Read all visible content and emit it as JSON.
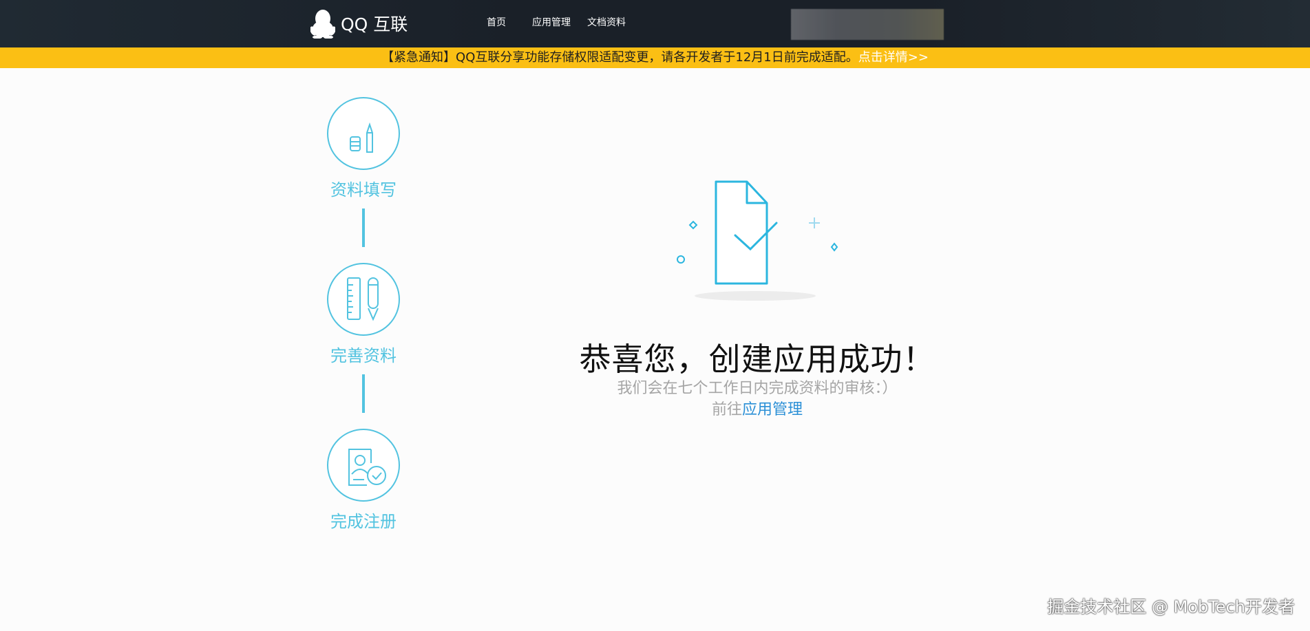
{
  "header": {
    "logo_text": "QQ 互联",
    "nav": [
      "首页",
      "应用管理",
      "文档资料"
    ]
  },
  "notice": {
    "text": "【紧急通知】QQ互联分享功能存储权限适配变更，请各开发者于12月1日前完成适配。",
    "link_text": "点击详情>>"
  },
  "steps": [
    {
      "label": "资料填写",
      "icon": "edit-tools-icon"
    },
    {
      "label": "完善资料",
      "icon": "ruler-pen-icon"
    },
    {
      "label": "完成注册",
      "icon": "profile-check-icon"
    }
  ],
  "main": {
    "title": "恭喜您，创建应用成功！",
    "subtitle": "我们会在七个工作日内完成资料的审核：）",
    "goto_prefix": "前往",
    "goto_link": "应用管理"
  },
  "watermark": "掘金技术社区 @ MobTech开发者",
  "colors": {
    "header_bg": "#1a2028",
    "notice_bg": "#fbbf14",
    "accent": "#52c3e0",
    "link": "#2a8fd6"
  }
}
